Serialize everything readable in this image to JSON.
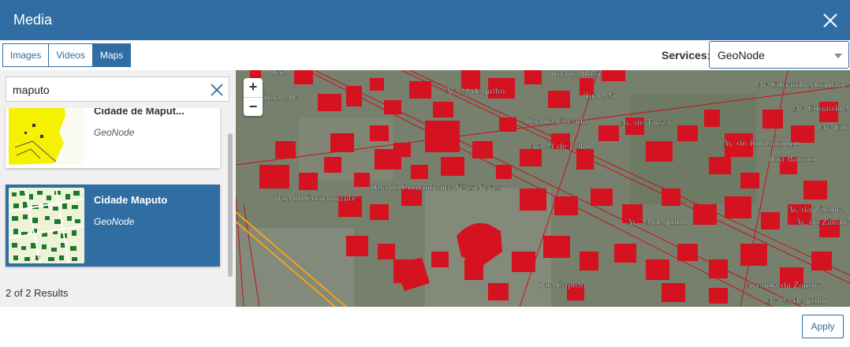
{
  "dialog": {
    "title": "Media"
  },
  "tabs": [
    {
      "label": "Images",
      "active": false
    },
    {
      "label": "Videos",
      "active": false
    },
    {
      "label": "Maps",
      "active": true
    }
  ],
  "services": {
    "label": "Services:",
    "selected": "GeoNode"
  },
  "search": {
    "query": "maputo"
  },
  "results": [
    {
      "title": "Cidade de Maput...",
      "service": "GeoNode",
      "selected": false
    },
    {
      "title": "Cidade Maputo",
      "service": "GeoNode",
      "selected": true
    }
  ],
  "results_count": "2 of 2 Results",
  "zoom": {
    "in": "+",
    "out": "−"
  },
  "map_labels": [
    "Av. 24 de Julho",
    "Av. 24 de Julho",
    "Av. 24 de Julho",
    "Rua da Udenda",
    "Av. de Tanza",
    "Rua do Comandante Félix Neves",
    "Rua do Comandante",
    "Av. do Rio Limpopo",
    "Av. Eduardo Mondlane",
    "Av. Eduardo M",
    "Av. Edu",
    "Rua 2.03",
    "Av. da Zâmbia",
    "Av. da Zâmbia",
    "Rua Barroso",
    "Avenida da Zâmbia",
    "Av. 24 de Julho",
    "Rua da Rosa",
    "Rua 225",
    "Rua Caputo",
    "Raz"
  ],
  "footer": {
    "apply_label": "Apply"
  },
  "colors": {
    "accent": "#2f6da3",
    "buildings": "#d5121f",
    "road": "#f2a31b"
  }
}
